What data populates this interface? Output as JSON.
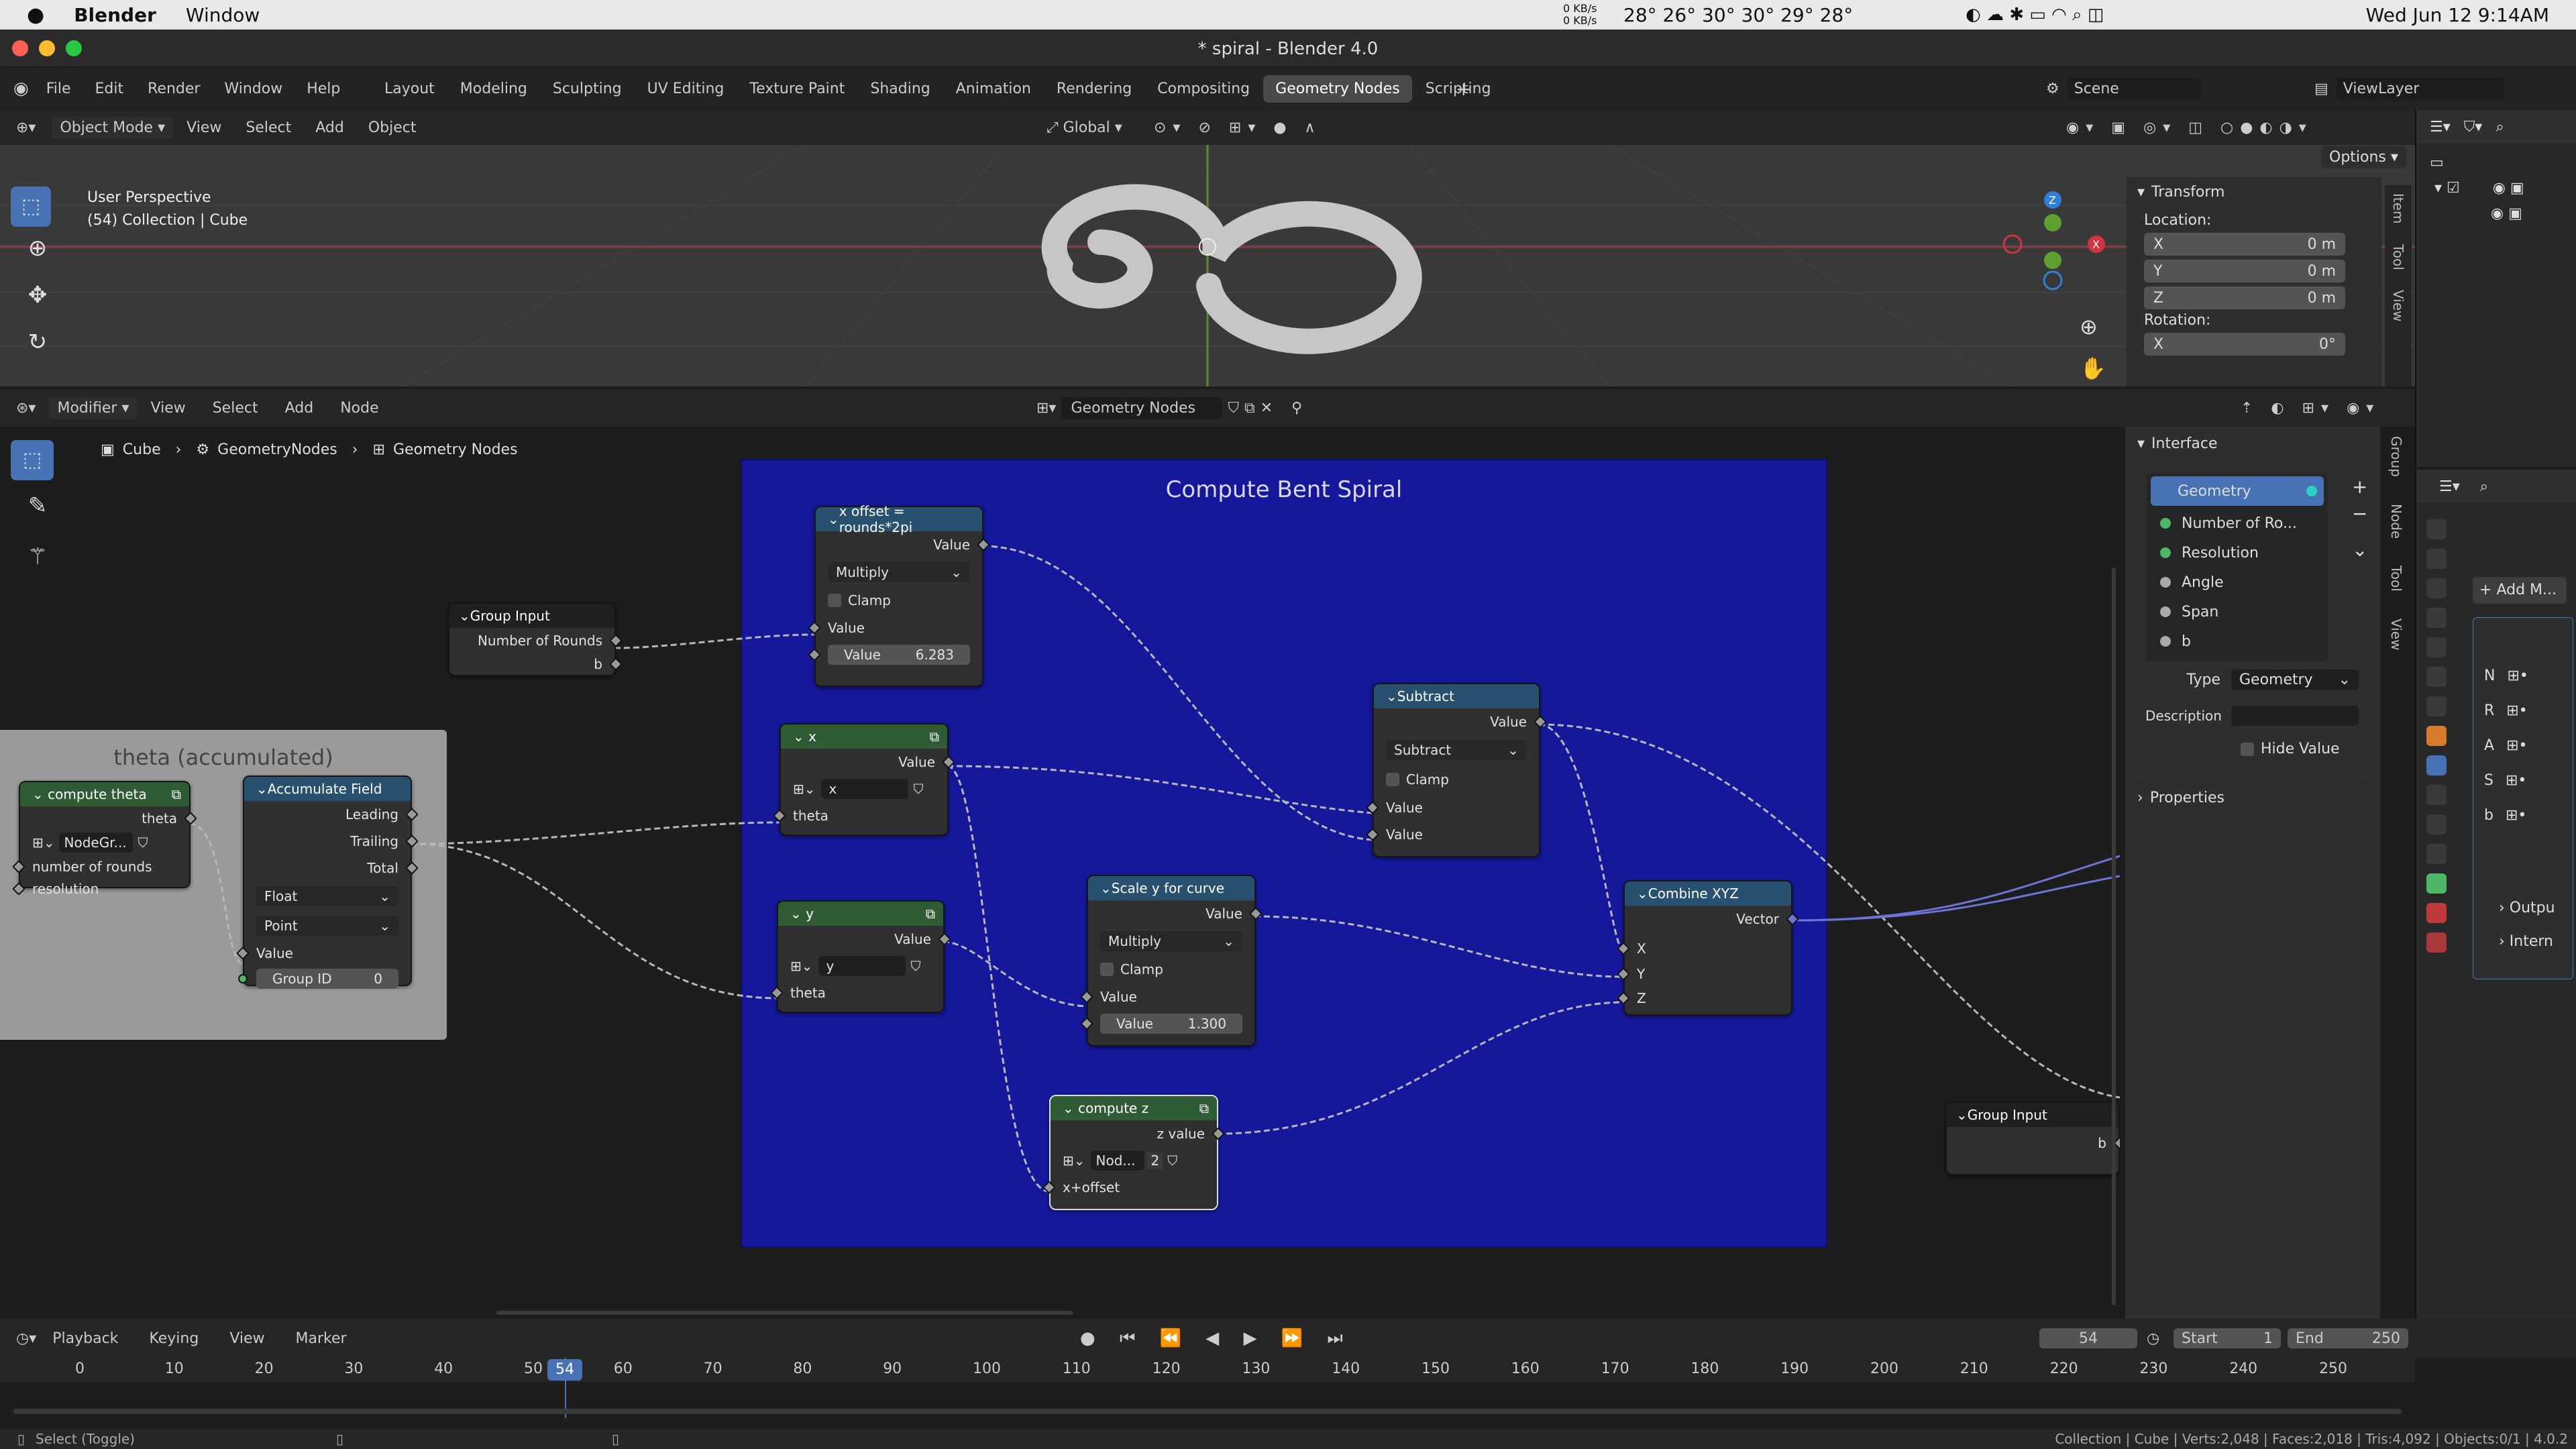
{
  "macbar": {
    "app": "Blender",
    "window_menu": "Window",
    "net_up": "0 KB/s",
    "net_down": "0 KB/s",
    "temps": "28° 26° 30° 30° 29° 28°",
    "clock": "Wed Jun 12  9:14AM"
  },
  "titlebar": {
    "title": "* spiral - Blender 4.0"
  },
  "topmenu": {
    "items": [
      "File",
      "Edit",
      "Render",
      "Window",
      "Help"
    ],
    "workspaces": [
      "Layout",
      "Modeling",
      "Sculpting",
      "UV Editing",
      "Texture Paint",
      "Shading",
      "Animation",
      "Rendering",
      "Compositing",
      "Geometry Nodes",
      "Scripting"
    ],
    "active_workspace": "Geometry Nodes",
    "scene": "Scene",
    "viewlayer": "ViewLayer"
  },
  "viewport": {
    "mode": "Object Mode",
    "menus": [
      "View",
      "Select",
      "Add",
      "Object"
    ],
    "orientation": "Global",
    "info_line1": "User Perspective",
    "info_line2": "(54) Collection | Cube",
    "options": "Options"
  },
  "npanel": {
    "header": "Transform",
    "location_label": "Location:",
    "loc": [
      {
        "axis": "X",
        "value": "0 m"
      },
      {
        "axis": "Y",
        "value": "0 m"
      },
      {
        "axis": "Z",
        "value": "0 m"
      }
    ],
    "rotation_label": "Rotation:",
    "rot_x_axis": "X",
    "rot_x": "0°",
    "tabs": [
      "Item",
      "Tool",
      "View"
    ]
  },
  "nodeeditor": {
    "editor_type": "Modifier",
    "menus": [
      "View",
      "Select",
      "Add",
      "Node"
    ],
    "tree_name": "Geometry Nodes",
    "breadcrumb": [
      "Cube",
      "GeometryNodes",
      "Geometry Nodes"
    ]
  },
  "frames": {
    "main": "Compute Bent Spiral",
    "left": "theta (accumulated)"
  },
  "nodes": {
    "xoffset": {
      "title": "x offset = rounds*2pi",
      "out": "Value",
      "op": "Multiply",
      "clamp": "Clamp",
      "in1": "Value",
      "in2_label": "Value",
      "in2_value": "6.283"
    },
    "groupinput1": {
      "title": "Group Input",
      "out1": "Number of Rounds",
      "out2": "b"
    },
    "x": {
      "title": "x",
      "out": "Value",
      "sel": "x",
      "in": "theta"
    },
    "y": {
      "title": "y",
      "out": "Value",
      "sel": "y",
      "in": "theta"
    },
    "subtract": {
      "title": "Subtract",
      "out": "Value",
      "op": "Subtract",
      "clamp": "Clamp",
      "in1": "Value",
      "in2": "Value"
    },
    "scaley": {
      "title": "Scale y for curve",
      "out": "Value",
      "op": "Multiply",
      "clamp": "Clamp",
      "in1": "Value",
      "in2_label": "Value",
      "in2_value": "1.300"
    },
    "combine": {
      "title": "Combine XYZ",
      "out": "Vector",
      "in": [
        "X",
        "Y",
        "Z"
      ]
    },
    "computez": {
      "title": "compute z",
      "out": "z value",
      "sel": "Nod...",
      "users": "2",
      "in": "x+offset"
    },
    "computetheta": {
      "title": "compute theta",
      "out": "theta",
      "sel": "NodeGr...",
      "in1": "number of rounds",
      "in2": "resolution"
    },
    "accum": {
      "title": "Accumulate Field",
      "out": [
        "Leading",
        "Trailing",
        "Total"
      ],
      "type": "Float",
      "domain": "Point",
      "in1": "Value",
      "in2_label": "Group ID",
      "in2_value": "0"
    },
    "groupinput2": {
      "title": "Group Input",
      "out": "b"
    }
  },
  "sidebar": {
    "interface": "Interface",
    "items": [
      "Geometry",
      "Number of Ro...",
      "Resolution",
      "Angle",
      "Span",
      "b"
    ],
    "type_label": "Type",
    "type_value": "Geometry",
    "desc_label": "Description",
    "hide_value": "Hide Value",
    "properties": "Properties",
    "tabs": [
      "Group",
      "Node",
      "Tool",
      "View"
    ]
  },
  "properties": {
    "add_modifier": "Add M...",
    "rows": [
      "N",
      "R",
      "A",
      "S",
      "b"
    ],
    "outputs": "Outpu",
    "internal": "Intern"
  },
  "timeline": {
    "menus": [
      "Playback",
      "Keying",
      "View",
      "Marker"
    ],
    "frame": "54",
    "start_label": "Start",
    "start": "1",
    "end_label": "End",
    "end": "250",
    "ticks": [
      "0",
      "10",
      "20",
      "30",
      "40",
      "50",
      "60",
      "70",
      "80",
      "90",
      "100",
      "110",
      "120",
      "130",
      "140",
      "150",
      "160",
      "170",
      "180",
      "190",
      "200",
      "210",
      "220",
      "230",
      "240",
      "250"
    ],
    "current": "54"
  },
  "statusbar": {
    "left": "Select (Toggle)",
    "right": "Collection | Cube | Verts:2,048 | Faces:2,018 | Tris:4,092 | Objects:0/1 | 4.0.2"
  }
}
